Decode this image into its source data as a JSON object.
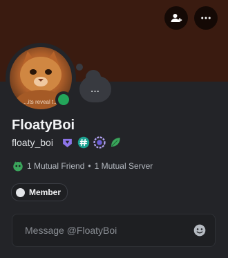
{
  "profile": {
    "display_name": "FloatyBoi",
    "username": "floaty_boi",
    "avatar_caption": "...its reveal t...",
    "status": "online",
    "status_color": "#23a55a",
    "banner_color": "#3a1b10"
  },
  "header": {
    "add_friend_icon": "add-friend-icon",
    "more_icon": "more-icon"
  },
  "activity_bubble": {
    "label": "..."
  },
  "badges": [
    "nitro-badge",
    "hashtag-badge",
    "boost-badge",
    "leaf-badge"
  ],
  "mutuals": {
    "friends": "1 Mutual Friend",
    "separator": "•",
    "servers": "1 Mutual Server"
  },
  "role": {
    "label": "Member"
  },
  "message": {
    "placeholder": "Message @FloatyBoi"
  }
}
